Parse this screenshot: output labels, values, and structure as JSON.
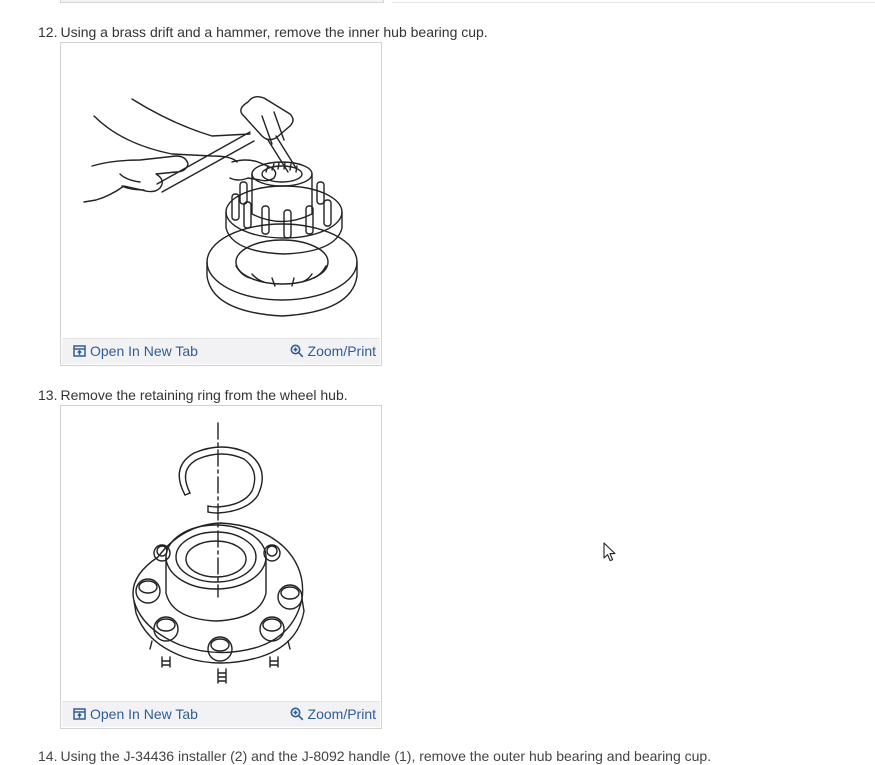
{
  "steps": [
    {
      "number": "12.",
      "text": "Using a brass drift and a hammer, remove the inner hub bearing cup.",
      "figure": {
        "open_label": "Open In New Tab",
        "zoom_label": "Zoom/Print"
      }
    },
    {
      "number": "13.",
      "text": "Remove the retaining ring from the wheel hub.",
      "figure": {
        "open_label": "Open In New Tab",
        "zoom_label": "Zoom/Print"
      }
    },
    {
      "number": "14.",
      "text": "Using the J-34436 installer (2) and the J-8092 handle (1), remove the outer hub bearing and bearing cup."
    }
  ],
  "colors": {
    "link": "#2f5d95",
    "toolbar_bg": "#f2f2f4",
    "frame_border": "#d2d2d2",
    "text": "#333333"
  },
  "icons": {
    "open": "open-in-new-tab-icon",
    "zoom": "zoom-magnifier-icon",
    "cursor": "mouse-pointer-icon"
  }
}
